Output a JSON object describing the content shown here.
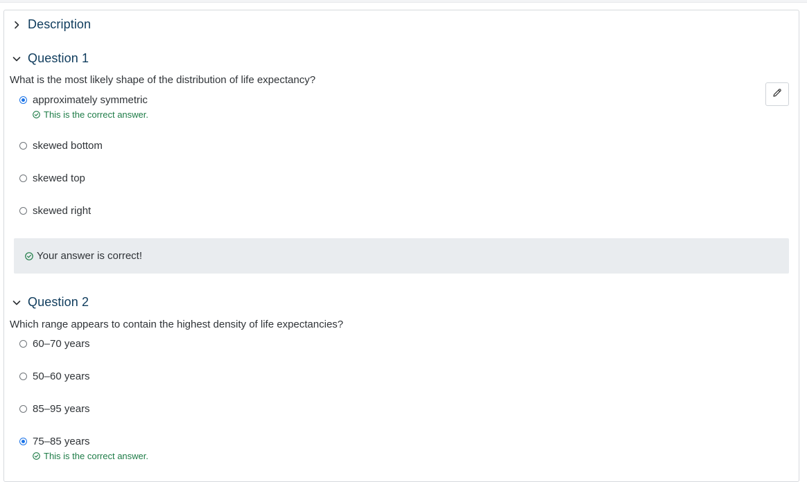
{
  "sections": {
    "description": {
      "title": "Description",
      "expanded": false
    },
    "question1": {
      "title": "Question 1",
      "prompt": "What is the most likely shape of the distribution of life expectancy?",
      "options": [
        {
          "label": "approximately symmetric",
          "selected": true
        },
        {
          "label": "skewed bottom",
          "selected": false
        },
        {
          "label": "skewed top",
          "selected": false
        },
        {
          "label": "skewed right",
          "selected": false
        }
      ],
      "correct_note": "This is the correct answer.",
      "feedback": "Your answer is correct!"
    },
    "question2": {
      "title": "Question 2",
      "prompt": "Which range appears to contain the highest density of life expectancies?",
      "options": [
        {
          "label": "60–70 years",
          "selected": false
        },
        {
          "label": "50–60 years",
          "selected": false
        },
        {
          "label": "85–95 years",
          "selected": false
        },
        {
          "label": "75–85 years",
          "selected": true
        }
      ],
      "correct_note": "This is the correct answer."
    }
  },
  "icons": {
    "edit": "pencil-icon",
    "collapsed": "chevron-right-icon",
    "expanded": "chevron-down-icon",
    "correct": "check-circle-icon"
  },
  "colors": {
    "heading": "#0e3b5c",
    "correct": "#1e7c47",
    "radio_selected": "#1a73e8",
    "feedback_bg": "#e9ecef"
  }
}
